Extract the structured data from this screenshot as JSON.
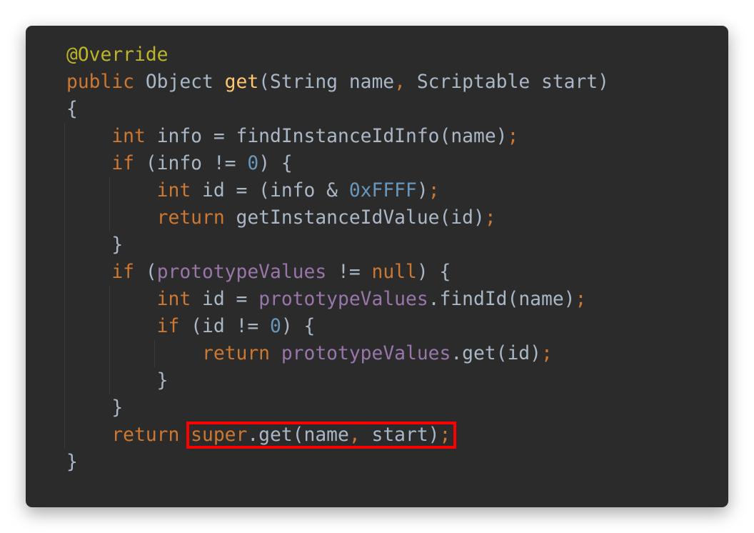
{
  "editor": {
    "lines": [
      [
        {
          "t": "@Override",
          "c": "ann"
        }
      ],
      [
        {
          "t": "public ",
          "c": "kw"
        },
        {
          "t": "Object ",
          "c": "txt"
        },
        {
          "t": "get",
          "c": "fn"
        },
        {
          "t": "(String name",
          "c": "txt"
        },
        {
          "t": ", ",
          "c": "kw"
        },
        {
          "t": "Scriptable start)",
          "c": "txt"
        }
      ],
      [
        {
          "t": "{",
          "c": "txt"
        }
      ],
      [
        {
          "t": "    "
        },
        {
          "t": "int ",
          "c": "kw"
        },
        {
          "t": "info = findInstanceIdInfo(name)",
          "c": "txt"
        },
        {
          "t": ";",
          "c": "kw"
        }
      ],
      [
        {
          "t": "    "
        },
        {
          "t": "if ",
          "c": "kw"
        },
        {
          "t": "(info != ",
          "c": "txt"
        },
        {
          "t": "0",
          "c": "num"
        },
        {
          "t": ") {",
          "c": "txt"
        }
      ],
      [
        {
          "t": "        "
        },
        {
          "t": "int ",
          "c": "kw"
        },
        {
          "t": "id = (info & ",
          "c": "txt"
        },
        {
          "t": "0xFFFF",
          "c": "num"
        },
        {
          "t": ")",
          "c": "txt"
        },
        {
          "t": ";",
          "c": "kw"
        }
      ],
      [
        {
          "t": "        "
        },
        {
          "t": "return ",
          "c": "kw"
        },
        {
          "t": "getInstanceIdValue(id)",
          "c": "txt"
        },
        {
          "t": ";",
          "c": "kw"
        }
      ],
      [
        {
          "t": "    "
        },
        {
          "t": "}",
          "c": "txt"
        }
      ],
      [
        {
          "t": "    "
        },
        {
          "t": "if ",
          "c": "kw"
        },
        {
          "t": "(",
          "c": "txt"
        },
        {
          "t": "prototypeValues ",
          "c": "fld"
        },
        {
          "t": "!= ",
          "c": "txt"
        },
        {
          "t": "null",
          "c": "kw"
        },
        {
          "t": ") {",
          "c": "txt"
        }
      ],
      [
        {
          "t": "        "
        },
        {
          "t": "int ",
          "c": "kw"
        },
        {
          "t": "id = ",
          "c": "txt"
        },
        {
          "t": "prototypeValues",
          "c": "fld"
        },
        {
          "t": ".findId(name)",
          "c": "txt"
        },
        {
          "t": ";",
          "c": "kw"
        }
      ],
      [
        {
          "t": "        "
        },
        {
          "t": "if ",
          "c": "kw"
        },
        {
          "t": "(id != ",
          "c": "txt"
        },
        {
          "t": "0",
          "c": "num"
        },
        {
          "t": ") {",
          "c": "txt"
        }
      ],
      [
        {
          "t": "            "
        },
        {
          "t": "return ",
          "c": "kw"
        },
        {
          "t": "prototypeValues",
          "c": "fld"
        },
        {
          "t": ".get(id)",
          "c": "txt"
        },
        {
          "t": ";",
          "c": "kw"
        }
      ],
      [
        {
          "t": "        "
        },
        {
          "t": "}",
          "c": "txt"
        }
      ],
      [
        {
          "t": "    "
        },
        {
          "t": "}",
          "c": "txt"
        }
      ],
      [
        {
          "t": "    "
        },
        {
          "t": "return ",
          "c": "kw"
        },
        {
          "t": "super",
          "c": "kw",
          "hl": "start"
        },
        {
          "t": ".get(name",
          "c": "txt",
          "hl": "mid"
        },
        {
          "t": ", ",
          "c": "kw",
          "hl": "mid"
        },
        {
          "t": "start)",
          "c": "txt",
          "hl": "mid"
        },
        {
          "t": ";",
          "c": "kw",
          "hl": "end"
        }
      ],
      [
        {
          "t": "}",
          "c": "txt"
        }
      ]
    ]
  },
  "colors": {
    "background": "#2b2b2b",
    "keyword": "#cc7832",
    "annotation": "#bbb529",
    "method": "#ffc66d",
    "number": "#6897bb",
    "field": "#9876aa",
    "text": "#a9b7c6",
    "highlight_box": "#ff0000"
  }
}
